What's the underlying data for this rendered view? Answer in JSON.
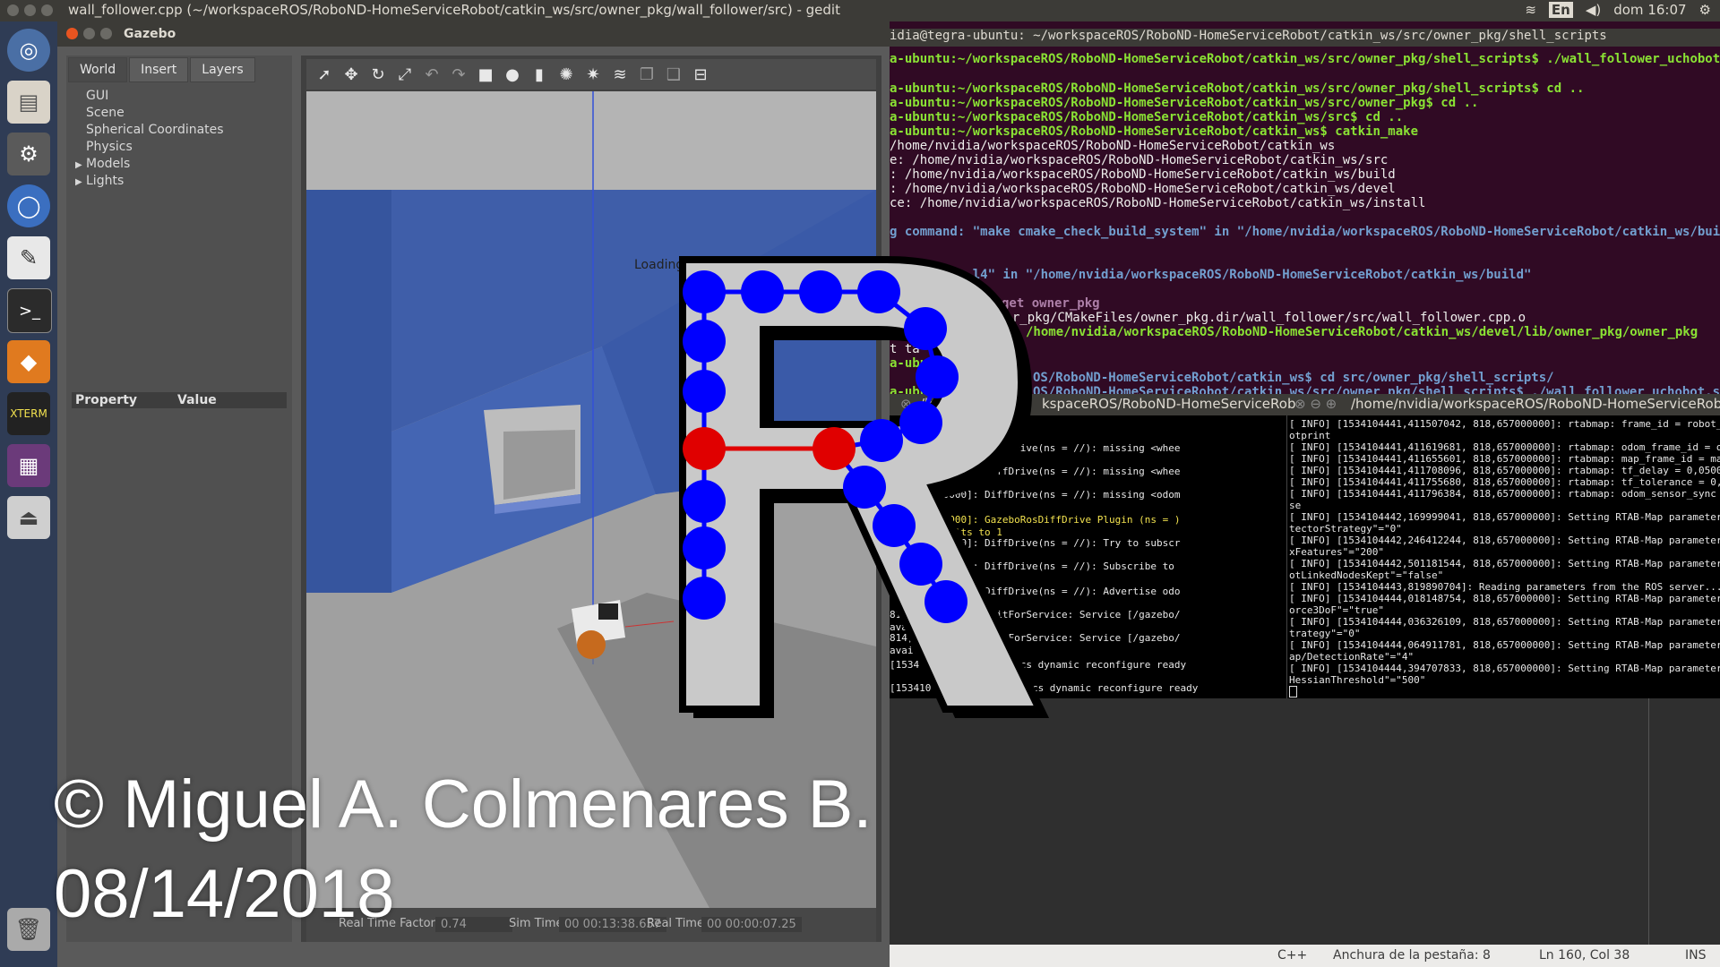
{
  "topbar": {
    "window_title": "wall_follower.cpp (~/workspaceROS/RoboND-HomeServiceRobot/catkin_ws/src/owner_pkg/wall_follower/src) - gedit",
    "keyboard": "En",
    "clock": "dom 16:07"
  },
  "gazebo": {
    "title": "Gazebo",
    "tabs": [
      "World",
      "Insert",
      "Layers"
    ],
    "tree": [
      "GUI",
      "Scene",
      "Spherical Coordinates",
      "Physics",
      "Models",
      "Lights"
    ],
    "property_header": "Property",
    "value_header": "Value",
    "loading": "Loading...",
    "status": {
      "real_time_factor_label": "Real Time Factor:",
      "real_time_factor": "0.74",
      "sim_time_label": "Sim Time:",
      "sim_time": "00 00:13:38.657",
      "real_time_label": "Real Time:",
      "real_time": "00 00:00:07.25"
    }
  },
  "terminal_top": {
    "title": "idia@tegra-ubuntu: ~/workspaceROS/RoboND-HomeServiceRobot/catkin_ws/src/owner_pkg/shell_scripts",
    "lines": [
      "a-ubuntu:~/workspaceROS/RoboND-HomeServiceRobot/catkin_ws/src/owner_pkg/shell_scripts$ ./wall_follower_uchobot.sh",
      "a-ubuntu:~/workspaceROS/RoboND-HomeServiceRobot/catkin_ws/src/owner_pkg/shell_scripts$ cd ..",
      "a-ubuntu:~/workspaceROS/RoboND-HomeServiceRobot/catkin_ws/src/owner_pkg$ cd ..",
      "a-ubuntu:~/workspaceROS/RoboND-HomeServiceRobot/catkin_ws/src$ cd ..",
      "a-ubuntu:~/workspaceROS/RoboND-HomeServiceRobot/catkin_ws$ catkin_make",
      "/home/nvidia/workspaceROS/RoboND-HomeServiceRobot/catkin_ws",
      "e: /home/nvidia/workspaceROS/RoboND-HomeServiceRobot/catkin_ws/src",
      ": /home/nvidia/workspaceROS/RoboND-HomeServiceRobot/catkin_ws/build",
      ": /home/nvidia/workspaceROS/RoboND-HomeServiceRobot/catkin_ws/devel",
      "ce: /home/nvidia/workspaceROS/RoboND-HomeServiceRobot/catkin_ws/install",
      "g command: \"make cmake_check_build_system\" in \"/home/nvidia/workspaceROS/RoboND-HomeServiceRobot/catkin_ws/build\"",
      "\"make -j4 -l4\" in \"/home/nvidia/workspaceROS/RoboND-HomeServiceRobot/catkin_ws/build\"",
      "get owner_pkg",
      "ner_pkg/CMakeFiles/owner_pkg.dir/wall_follower/src/wall_follower.cpp.o",
      "/home/nvidia/workspaceROS/RoboND-HomeServiceRobot/catkin_ws/devel/lib/owner_pkg/owner_pkg",
      "t ta",
      "a-ubun",
      "OS/RoboND-HomeServiceRobot/catkin_ws$ cd src/owner_pkg/shell_scripts/",
      "a-ubun",
      "OS/RoboND-HomeServiceRobot/catkin_ws/src/owner_pkg/shell_scripts$ ./wall_follower_uchobot.sh"
    ]
  },
  "terminal_bottom": {
    "tab1": "/ho",
    "tab1b": "kspaceROS/RoboND-HomeServiceRob",
    "tab2": "/home/nvidia/workspaceROS/RoboND-HomeServiceRob",
    "left_lines": [
      "elJoints",
      "[15",
      "014,487000000]: DiffDrive(ns = //): missing <whee",
      "014,487000000]: DiffDrive(ns = //): missing <whee",
      "014,487000000]: DiffDrive(ns = //): missing <odom",
      "014,487000000]: GazeboRosDiffDrive Plugin (ns = )",
      "hTF>, defaults to 1",
      "014,487000000]: DiffDrive(ns = //): Try to subscr",
      "814,487000000]: DiffDrive(ns = //): Subscribe to",
      "814,487000000]: DiffDrive(ns = //): Advertise odo",
      "814,515000000]: waitForService: Service [/gazebo/",
      "available.",
      "814,524000000]: waitForService: Service [/gazebo/",
      "available.",
      "[1534 44000000]: Physics dynamic reconfigure ready",
      "[153410 45000000]: Physics dynamic reconfigure ready"
    ],
    "right_lines": [
      "[ INFO] [1534104441,411507042, 818,657000000]: rtabmap: frame_id      = robot_fo",
      "otprint",
      "[ INFO] [1534104441,411619681, 818,657000000]: rtabmap: odom_frame_id = odom",
      "[ INFO] [1534104441,411655601, 818,657000000]: rtabmap: map_frame_id  = map",
      "[ INFO] [1534104441,411708096, 818,657000000]: rtabmap: tf_delay      = 0,050000",
      "[ INFO] [1534104441,411755680, 818,657000000]: rtabmap: tf_tolerance  = 0,100000",
      "[ INFO] [1534104441,411796384, 818,657000000]: rtabmap: odom_sensor_sync   = fal",
      "se",
      "[ INFO] [1534104442,169999041, 818,657000000]: Setting RTAB-Map parameter \"Kp/De",
      "tectorStrategy\"=\"0\"",
      "[ INFO] [1534104442,246412244, 818,657000000]: Setting RTAB-Map parameter \"Kp/Ma",
      "xFeatures\"=\"200\"",
      "[ INFO] [1534104442,501181544, 818,657000000]: Setting RTAB-Map parameter \"Mem/N",
      "otLinkedNodesKept\"=\"false\"",
      "[ INFO] [1534104443,819890704]: Reading parameters from the ROS server...",
      "[ INFO] [1534104444,018148754, 818,657000000]: Setting RTAB-Map parameter \"Reg/F",
      "orce3DoF\"=\"true\"",
      "[ INFO] [1534104444,036326109, 818,657000000]: Setting RTAB-Map parameter \"Reg/S",
      "trategy\"=\"0\"",
      "[ INFO] [1534104444,064911781, 818,657000000]: Setting RTAB-Map parameter \"Rtabm",
      "ap/DetectionRate\"=\"4\"",
      "[ INFO] [1534104444,394707833, 818,657000000]: Setting RTAB-Map parameter \"SURF/",
      "HessianThreshold\"=\"500\""
    ]
  },
  "gedit_status": {
    "language": "C++",
    "tab_width": "Anchura de la pestaña: 8",
    "position": "Ln 160, Col 38",
    "mode": "INS"
  },
  "watermark": {
    "line1": "© Miguel A. Colmenares B.",
    "line2": "08/14/2018"
  },
  "colors": {
    "terminal_bg": "#300a24",
    "launcher_bg": "#2f3c55",
    "gazebo_wall": "#3a5aa8",
    "logo_red": "#e00000",
    "logo_blue": "#0000ff"
  }
}
